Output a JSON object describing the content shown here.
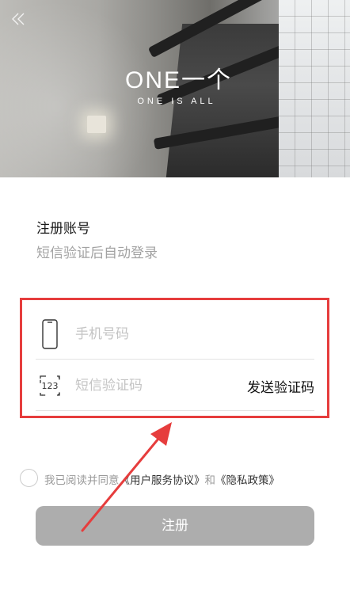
{
  "header": {
    "back_icon": "double-chevron-left-icon",
    "logo_main": "ONE一个",
    "logo_sub": "ONE IS ALL"
  },
  "form": {
    "title": "注册账号",
    "subtitle": "短信验证后自动登录",
    "phone": {
      "icon": "phone-icon",
      "placeholder": "手机号码",
      "value": ""
    },
    "code": {
      "icon": "sms-code-icon",
      "icon_text": "123",
      "placeholder": "短信验证码",
      "value": "",
      "send_label": "发送验证码"
    }
  },
  "agreement": {
    "prefix": "我已阅读并同意",
    "terms_link": "《用户服务协议》",
    "conjunction": "和",
    "privacy_link": "《隐私政策》",
    "checked": false
  },
  "submit": {
    "label": "注册"
  },
  "colors": {
    "highlight": "#e63d3d",
    "button_disabled": "#adadad",
    "placeholder": "#c4c4c4",
    "subtitle": "#a3a3a3"
  }
}
